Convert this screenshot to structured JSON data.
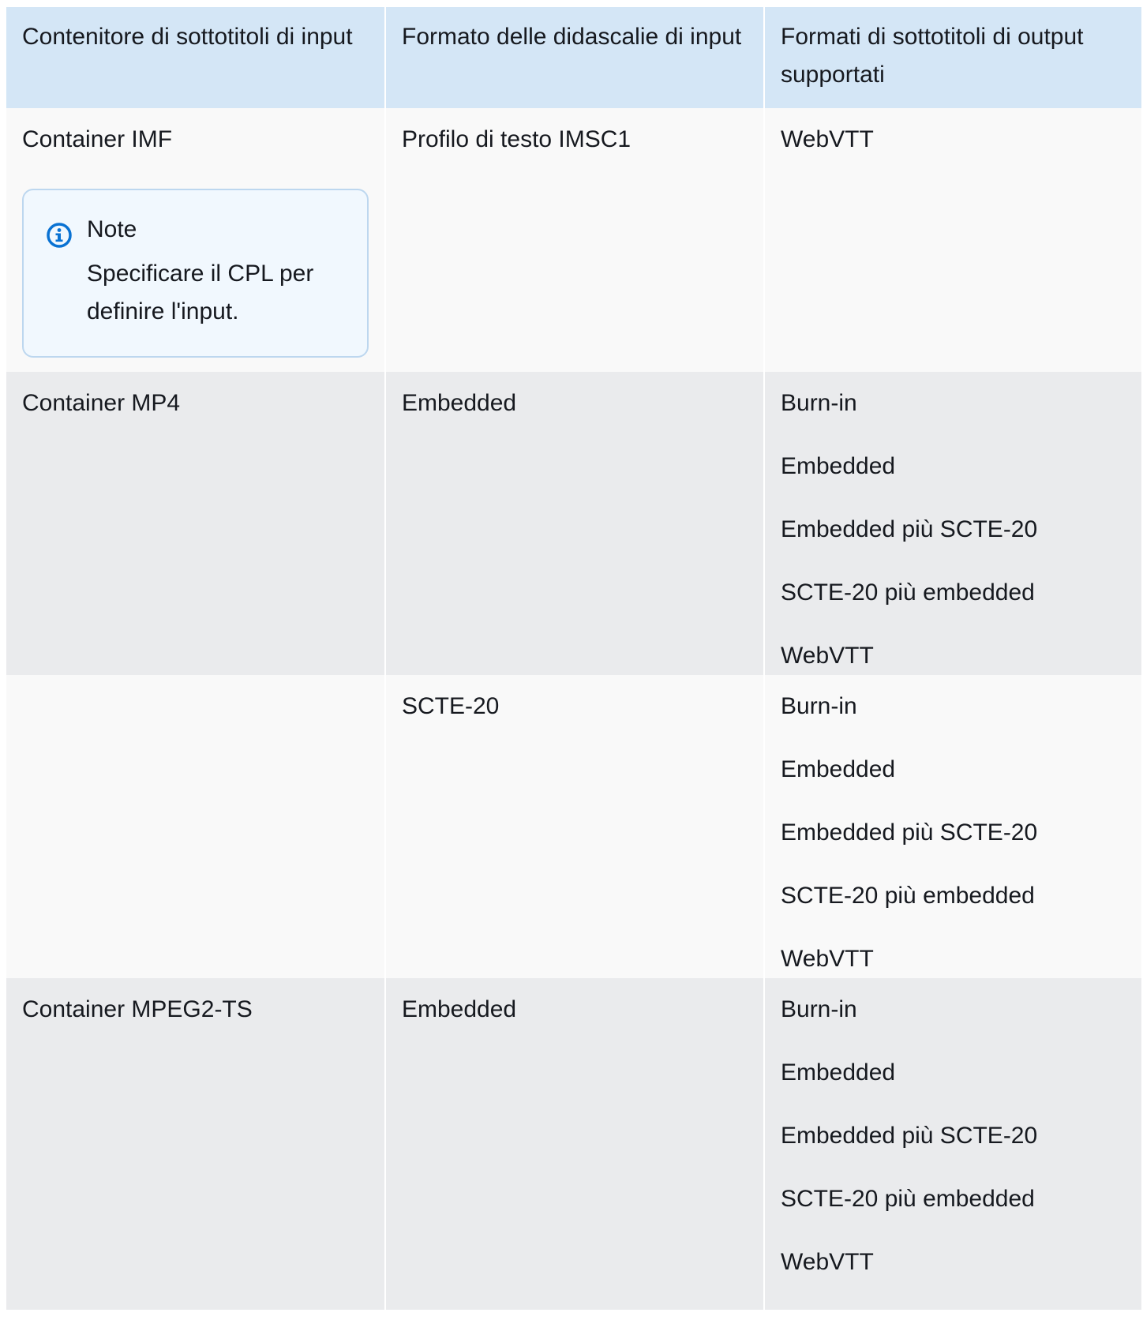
{
  "table": {
    "headers": [
      "Contenitore di sottotitoli di input",
      "Formato delle didascalie di input",
      "Formati di sottotitoli di output supportati"
    ],
    "rows": [
      {
        "container": "Container IMF",
        "note": {
          "title": "Note",
          "text": "Specificare il CPL per definire l'input."
        },
        "input_format": "Profilo di testo IMSC1",
        "outputs": [
          "WebVTT"
        ]
      },
      {
        "container": "Container MP4",
        "input_format": "Embedded",
        "outputs": [
          "Burn-in",
          "Embedded",
          "Embedded più SCTE-20",
          "SCTE-20 più embedded",
          "WebVTT"
        ]
      },
      {
        "container": "",
        "input_format": "SCTE-20",
        "outputs": [
          "Burn-in",
          "Embedded",
          "Embedded più SCTE-20",
          "SCTE-20 più embedded",
          "WebVTT"
        ]
      },
      {
        "container": "Container MPEG2-TS",
        "input_format": "Embedded",
        "outputs": [
          "Burn-in",
          "Embedded",
          "Embedded più SCTE-20",
          "SCTE-20 più embedded",
          "WebVTT"
        ]
      }
    ]
  },
  "icons": {
    "note_icon": "info-icon",
    "accent": "#0972d3"
  }
}
